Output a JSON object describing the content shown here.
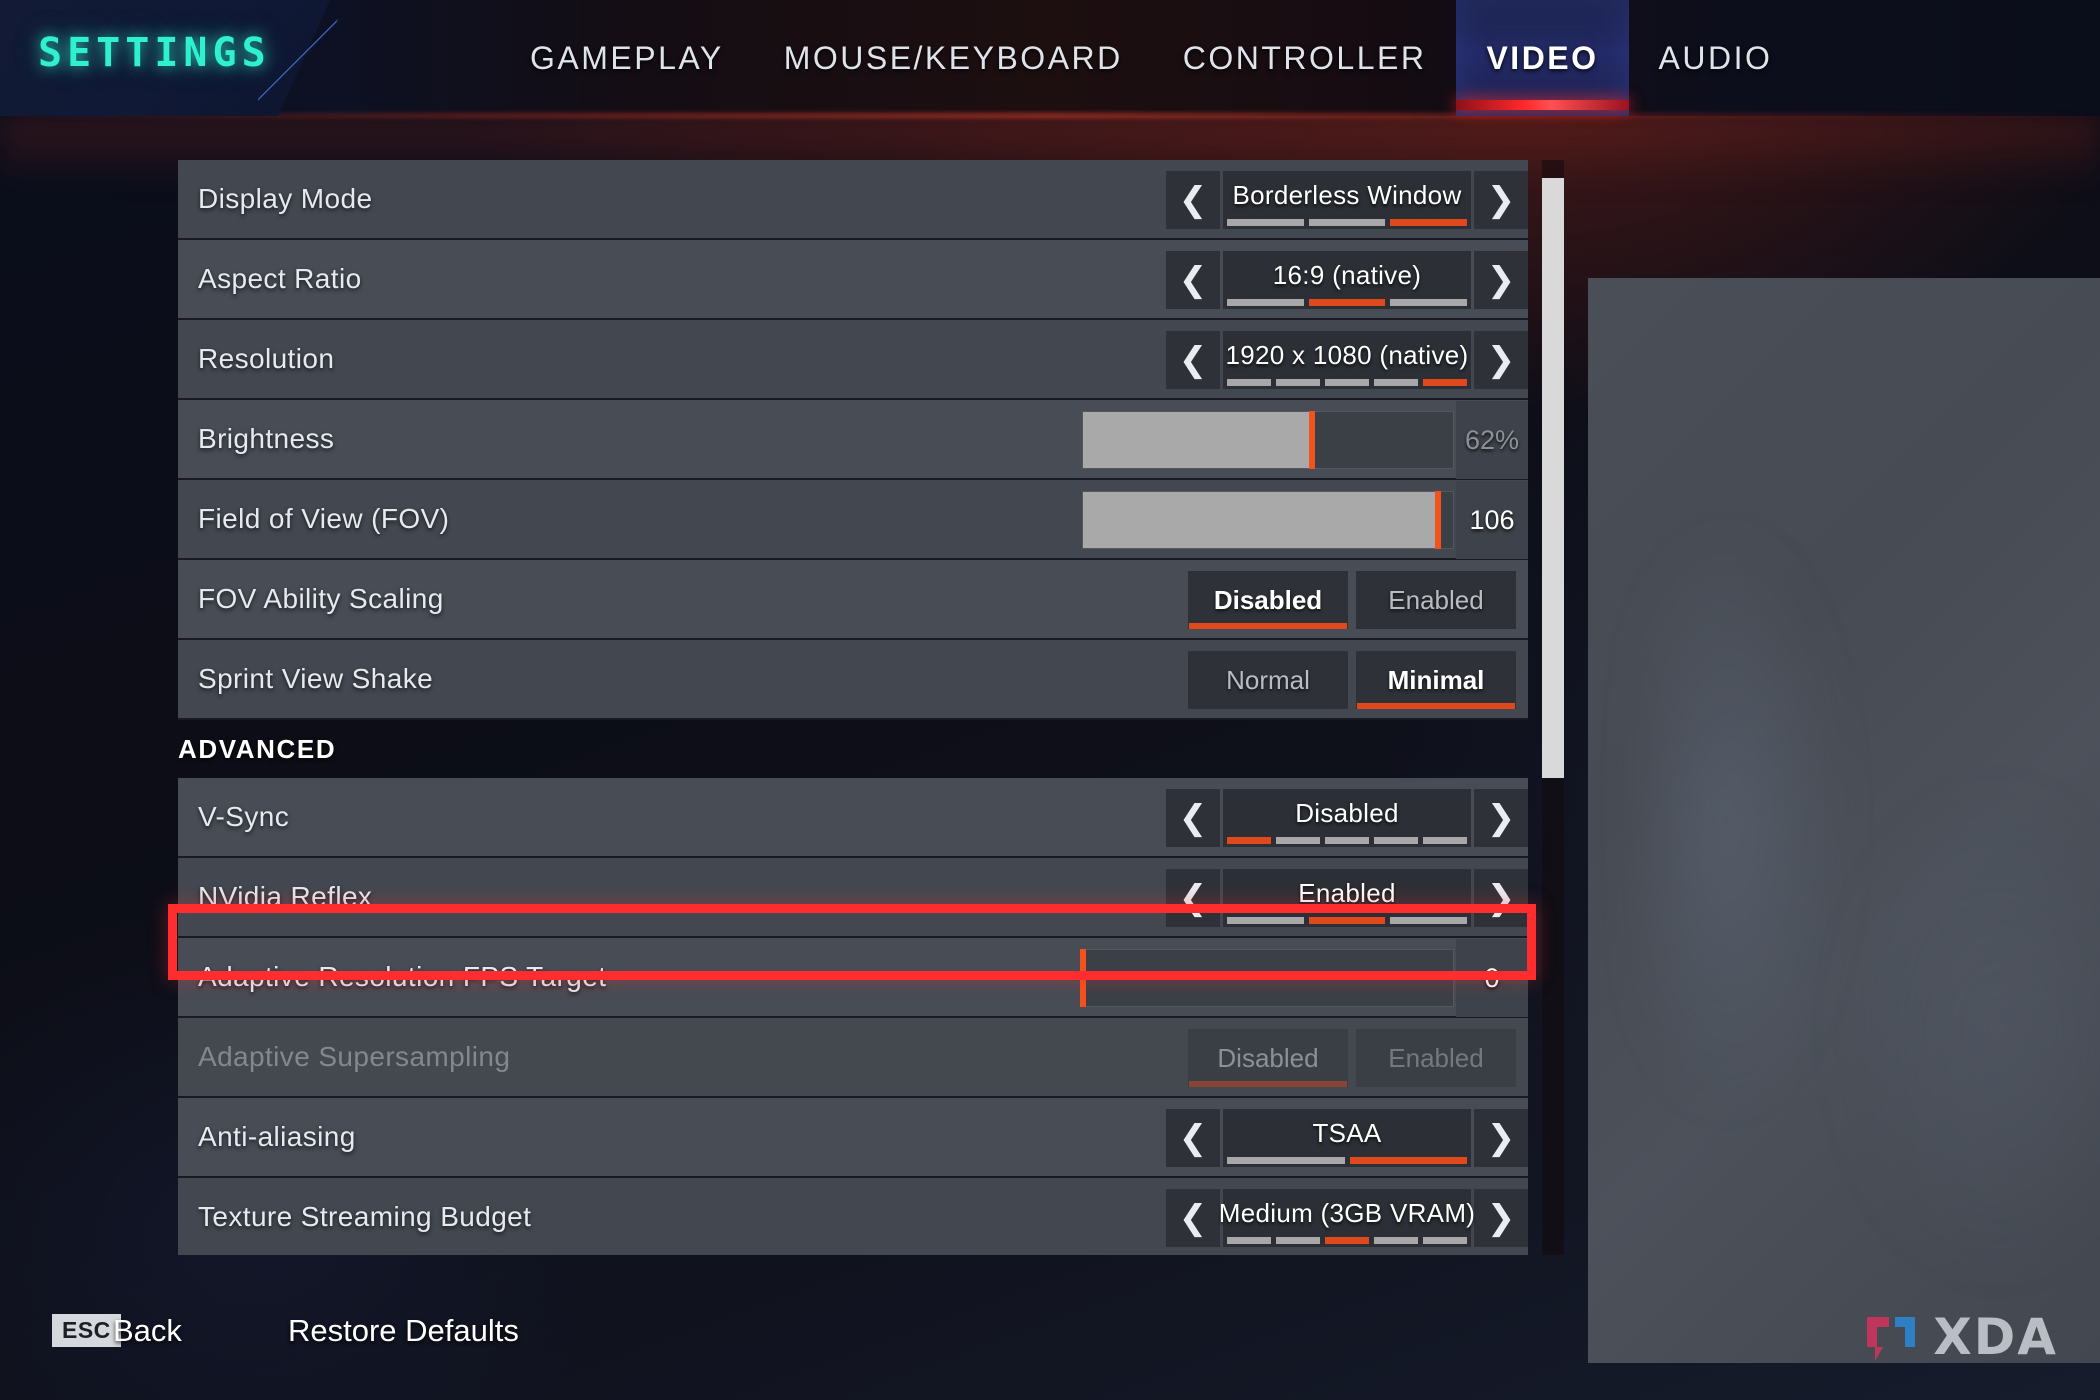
{
  "header": {
    "title": "SETTINGS",
    "tabs": [
      {
        "label": "GAMEPLAY",
        "active": false
      },
      {
        "label": "MOUSE/KEYBOARD",
        "active": false
      },
      {
        "label": "CONTROLLER",
        "active": false
      },
      {
        "label": "VIDEO",
        "active": true
      },
      {
        "label": "AUDIO",
        "active": false
      }
    ]
  },
  "colors": {
    "accent_orange": "#e0491c",
    "highlight_red": "#ff2d2d",
    "title_cyan": "#2ff0cf",
    "active_tab_underline": "#ff2a2a",
    "row_bg": "#434850",
    "slider_fill": "#a9a9a9"
  },
  "icons": {
    "arrow_left": "❮",
    "arrow_right": "❯"
  },
  "settings": {
    "section_advanced_label": "ADVANCED",
    "rows": [
      {
        "name": "display-mode",
        "label": "Display Mode",
        "type": "stepper",
        "value": "Borderless Window",
        "segments": 3,
        "selected_segment": 3,
        "disabled": false
      },
      {
        "name": "aspect-ratio",
        "label": "Aspect Ratio",
        "type": "stepper",
        "value": "16:9 (native)",
        "segments": 3,
        "selected_segment": 2,
        "disabled": false
      },
      {
        "name": "resolution",
        "label": "Resolution",
        "type": "stepper",
        "value": "1920 x 1080 (native)",
        "segments": 5,
        "selected_segment": 5,
        "disabled": false
      },
      {
        "name": "brightness",
        "label": "Brightness",
        "type": "slider",
        "value": "62%",
        "percent": 62,
        "disabled": false
      },
      {
        "name": "field-of-view",
        "label": "Field of View (FOV)",
        "type": "slider",
        "value": "106",
        "percent": 96,
        "disabled": false
      },
      {
        "name": "fov-ability-scaling",
        "label": "FOV Ability Scaling",
        "type": "toggle",
        "options": [
          "Disabled",
          "Enabled"
        ],
        "selected": 0,
        "disabled": false
      },
      {
        "name": "sprint-view-shake",
        "label": "Sprint View Shake",
        "type": "toggle",
        "options": [
          "Normal",
          "Minimal"
        ],
        "selected": 1,
        "disabled": false
      },
      {
        "name": "v-sync",
        "label": "V-Sync",
        "type": "stepper",
        "value": "Disabled",
        "segments": 5,
        "selected_segment": 1,
        "disabled": false,
        "highlighted": true
      },
      {
        "name": "nvidia-reflex",
        "label": "NVidia Reflex",
        "type": "stepper",
        "value": "Enabled",
        "segments": 3,
        "selected_segment": 2,
        "disabled": false
      },
      {
        "name": "adaptive-resolution-fps-target",
        "label": "Adaptive Resolution FPS Target",
        "type": "slider",
        "value": "0",
        "percent": 0,
        "disabled": false
      },
      {
        "name": "adaptive-supersampling",
        "label": "Adaptive Supersampling",
        "type": "toggle",
        "options": [
          "Disabled",
          "Enabled"
        ],
        "selected": 0,
        "disabled": true
      },
      {
        "name": "anti-aliasing",
        "label": "Anti-aliasing",
        "type": "stepper",
        "value": "TSAA",
        "segments": 2,
        "selected_segment": 2,
        "disabled": false
      },
      {
        "name": "texture-streaming-budget",
        "label": "Texture Streaming Budget",
        "type": "stepper",
        "value": "Medium (3GB VRAM)",
        "segments": 5,
        "selected_segment": 3,
        "disabled": false
      }
    ]
  },
  "footer": {
    "esc_key": "ESC",
    "back_label": "Back",
    "restore_defaults_label": "Restore Defaults"
  },
  "watermark": {
    "text": "XDA"
  }
}
